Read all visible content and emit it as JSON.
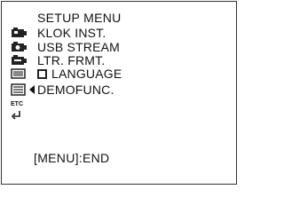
{
  "menu": {
    "title": "SETUP MENU",
    "items": [
      {
        "label": "KLOK INST.",
        "icon": "camera-tape-icon"
      },
      {
        "label": "USB STREAM",
        "icon": "camera-memory-icon"
      },
      {
        "label": "LTR. FRMT.",
        "icon": "camera-settings-icon"
      },
      {
        "label": "LANGUAGE",
        "icon": "language-icon"
      },
      {
        "label": "DEMOFUNC.",
        "icon": "setup-menu-icon"
      }
    ],
    "etc_label": "ETC"
  },
  "footer": {
    "hint": "[MENU]:END"
  }
}
